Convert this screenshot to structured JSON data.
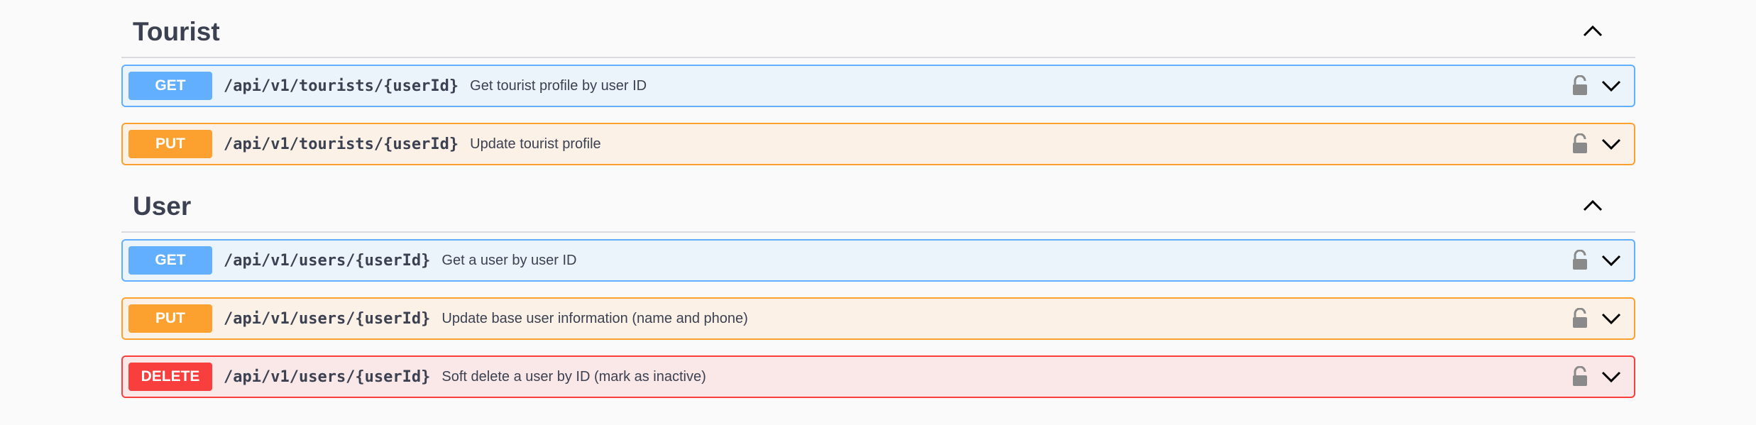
{
  "sections": [
    {
      "title": "Tourist",
      "operations": [
        {
          "method": "GET",
          "path": "/api/v1/tourists/{userId}",
          "summary": "Get tourist profile by user ID"
        },
        {
          "method": "PUT",
          "path": "/api/v1/tourists/{userId}",
          "summary": "Update tourist profile"
        }
      ]
    },
    {
      "title": "User",
      "operations": [
        {
          "method": "GET",
          "path": "/api/v1/users/{userId}",
          "summary": "Get a user by user ID"
        },
        {
          "method": "PUT",
          "path": "/api/v1/users/{userId}",
          "summary": "Update base user information (name and phone)"
        },
        {
          "method": "DELETE",
          "path": "/api/v1/users/{userId}",
          "summary": "Soft delete a user by ID (mark as inactive)"
        }
      ]
    }
  ],
  "colors": {
    "get": "#61affe",
    "put": "#fca130",
    "delete": "#f93e3e",
    "text": "#3b4151"
  },
  "icons": {
    "collapse": "chevron-up-icon",
    "expand": "chevron-down-icon",
    "lock": "lock-icon"
  }
}
